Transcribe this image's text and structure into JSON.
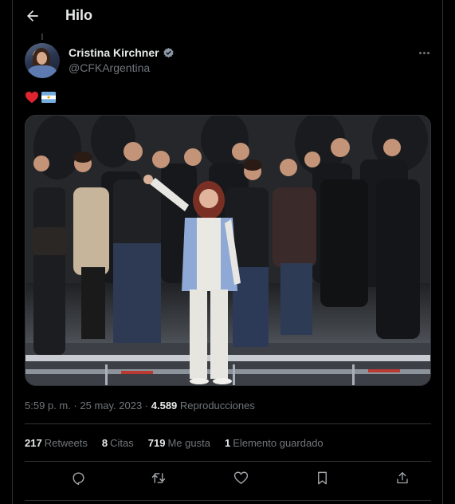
{
  "header": {
    "title": "Hilo"
  },
  "author": {
    "name": "Cristina Kirchner",
    "handle": "@CFKArgentina",
    "verified": true
  },
  "tweet": {
    "emoji": [
      "red-heart",
      "argentina-flag"
    ]
  },
  "meta": {
    "time": "5:59 p. m.",
    "separator1": " · ",
    "date": "25 may. 2023",
    "separator2": " · ",
    "views_count": "4.589",
    "views_label": "Reproducciones"
  },
  "stats": [
    {
      "count": "217",
      "label": "Retweets"
    },
    {
      "count": "8",
      "label": "Citas"
    },
    {
      "count": "719",
      "label": "Me gusta"
    },
    {
      "count": "1",
      "label": "Elemento guardado"
    }
  ],
  "actions": [
    "reply-icon",
    "retweet-icon",
    "like-icon",
    "bookmark-icon",
    "share-icon"
  ],
  "colors": {
    "background": "#000000",
    "text": "#e7e9ea",
    "muted": "#71767b",
    "divider": "#2f3336",
    "verified": "#8b98a5"
  }
}
